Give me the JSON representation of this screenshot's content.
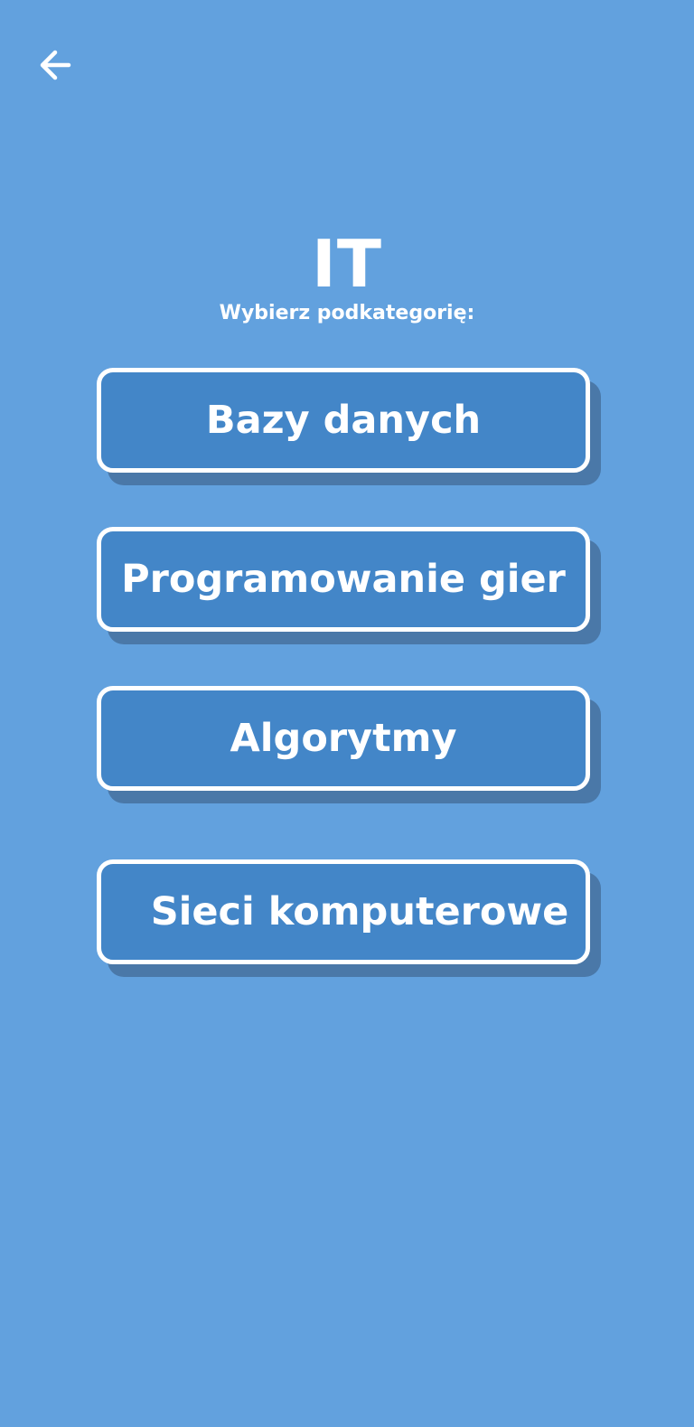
{
  "header": {
    "back_icon": "arrow-left-icon"
  },
  "title": "IT",
  "subtitle": "Wybierz podkategorię:",
  "categories": [
    {
      "label": "Bazy danych"
    },
    {
      "label": "Programowanie gier"
    },
    {
      "label": "Algorytmy"
    },
    {
      "label": "Sieci komputerowe"
    }
  ],
  "colors": {
    "background": "#62a1de",
    "button_fill": "#4386c8",
    "button_border": "#ffffff",
    "button_shadow": "#4a78a8",
    "text": "#ffffff"
  }
}
